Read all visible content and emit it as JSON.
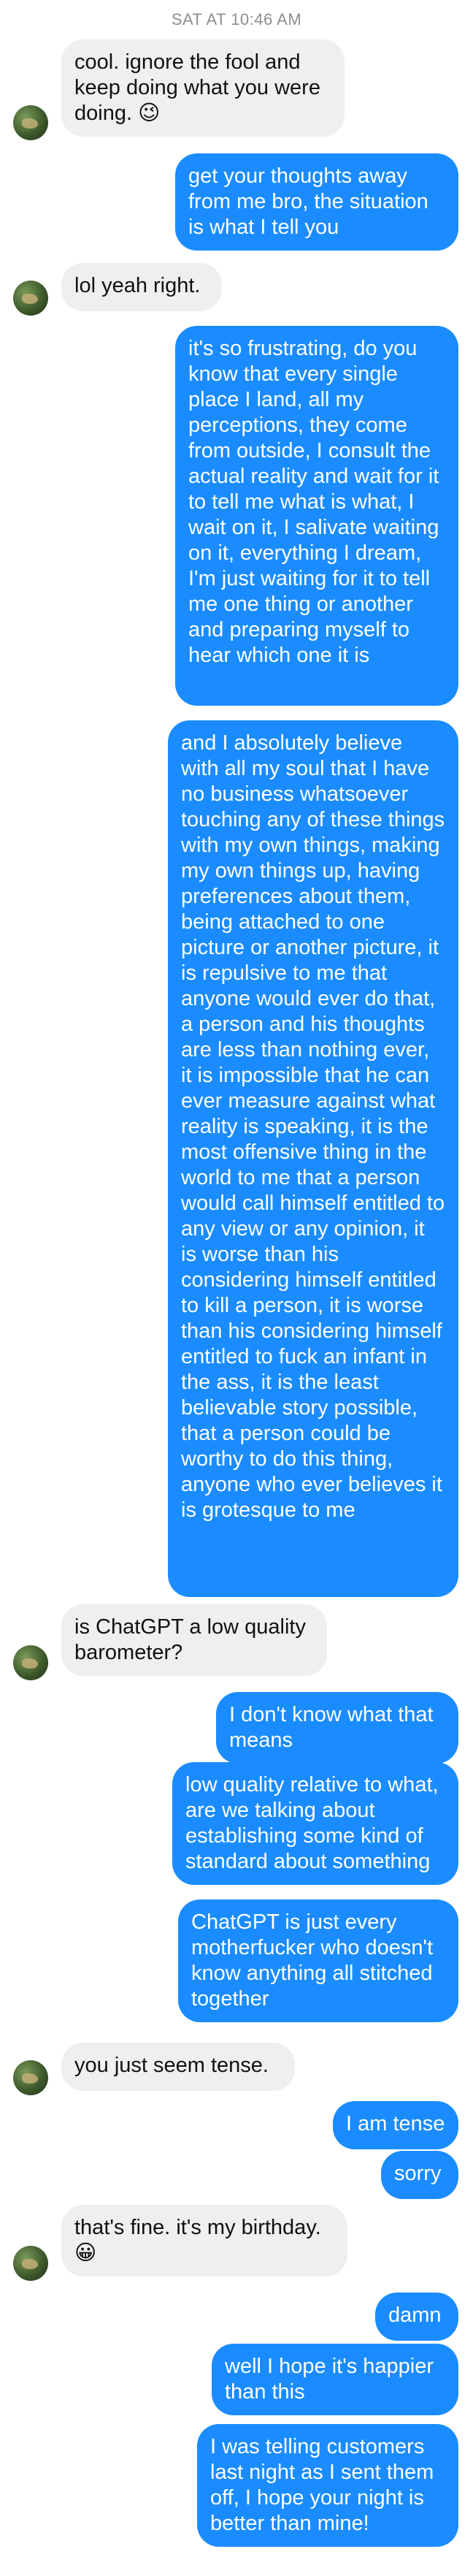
{
  "timestamp": "SAT AT 10:46 AM",
  "messages": [
    {
      "side": "in",
      "text": "cool. ignore the fool and keep doing what you were doing. 😉"
    },
    {
      "side": "out",
      "text": "get your thoughts away from me bro, the situation is what I tell you"
    },
    {
      "side": "in",
      "text": "lol yeah right."
    },
    {
      "side": "out",
      "text": "it's so frustrating, do you know that every single place I land, all my perceptions, they come from outside, I consult the actual reality and wait for it to tell me what is what, I wait on it, I salivate waiting on it, everything I dream, I'm just waiting for it to tell me one thing or another and preparing myself to hear which one it is"
    },
    {
      "side": "out",
      "text": "and I absolutely believe with all my soul that I have no business whatsoever touching any of these things with my own things, making my own things up, having preferences about them, being attached to one picture or another picture, it is repulsive to me that anyone would ever do that, a person and his thoughts are less than nothing ever, it is impossible that he can ever measure against what reality is speaking, it is the most offensive thing in the world to me that a person would call himself entitled to any view or any opinion, it is worse than his considering himself entitled to kill a person, it is worse than his considering himself entitled to fuck an infant in the ass, it is the least believable story possible, that a person could be worthy to do this thing, anyone who ever believes it is grotesque to me"
    },
    {
      "side": "in",
      "text": "is ChatGPT a low quality barometer?"
    },
    {
      "side": "out",
      "text": "I don't know what that means"
    },
    {
      "side": "out",
      "text": "low quality relative to what, are we talking about establishing some kind of standard about something"
    },
    {
      "side": "out",
      "text": "ChatGPT is just every motherfucker who doesn't know anything all stitched together"
    },
    {
      "side": "in",
      "text": "you just seem tense."
    },
    {
      "side": "out",
      "text": "I am tense"
    },
    {
      "side": "out",
      "text": "sorry"
    },
    {
      "side": "in",
      "text": "that's fine. it's my birthday. 😀"
    },
    {
      "side": "out",
      "text": "damn"
    },
    {
      "side": "out",
      "text": "well I hope it's happier than this"
    },
    {
      "side": "out",
      "text": "I was telling customers last night as I sent them off, I hope your night is better than mine!"
    }
  ]
}
